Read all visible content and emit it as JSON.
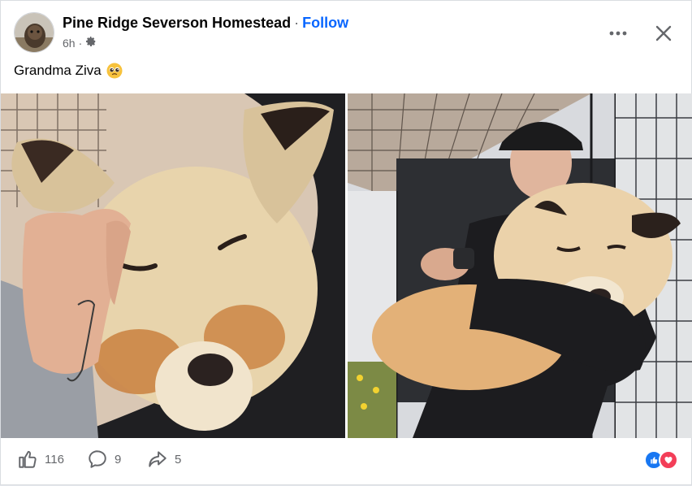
{
  "post": {
    "author": "Pine Ridge Severson Homestead",
    "separator": "·",
    "follow_label": "Follow",
    "time": "6h",
    "meta_dot": "·",
    "caption": "Grandma Ziva"
  },
  "footer": {
    "likes": "116",
    "comments": "9",
    "shares": "5"
  },
  "icons": {
    "audience": "gear-icon",
    "more": "more-dots-icon",
    "close": "close-icon",
    "like": "thumbs-up-icon",
    "comment": "comment-bubble-icon",
    "share": "share-arrow-icon",
    "reaction_like": "like-reaction-icon",
    "reaction_love": "love-reaction-icon",
    "caption_emoji": "pleading-face-emoji"
  },
  "colors": {
    "link": "#0866ff",
    "secondary_text": "#65676b",
    "reaction_like": "#1877f2",
    "reaction_love": "#f33e58"
  }
}
